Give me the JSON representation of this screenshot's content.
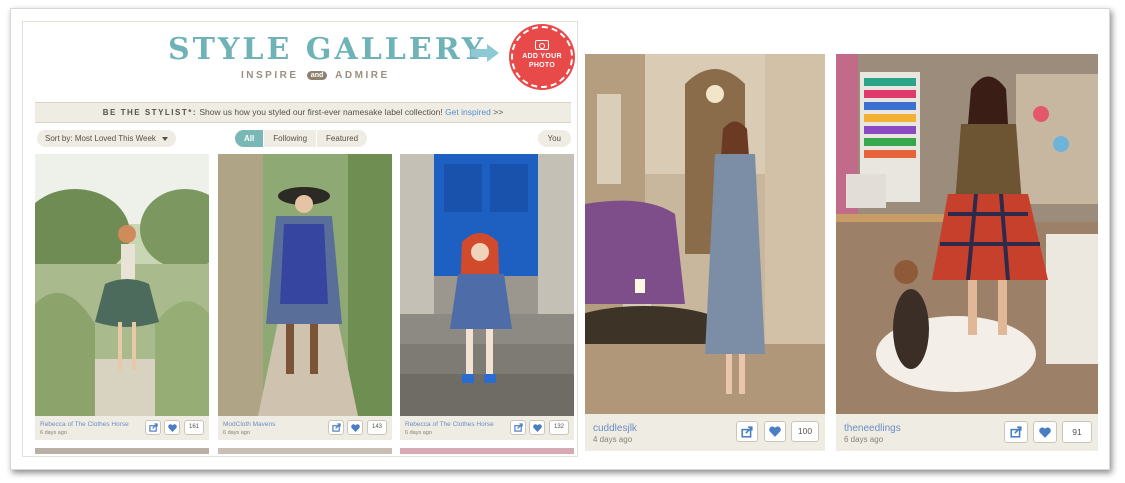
{
  "header": {
    "title": "STYLE GALLERY",
    "subtitle_left": "INSPIRE",
    "subtitle_and": "and",
    "subtitle_right": "ADMIRE",
    "add_photo_label_1": "ADD YOUR",
    "add_photo_label_2": "PHOTO",
    "accent_color": "#6fb3b8",
    "add_color": "#e84a4a"
  },
  "banner": {
    "lead": "BE THE STYLIST*:",
    "text": " Show us how you styled our first-ever namesake label collection! ",
    "link": "Get inspired",
    "suffix": " >>"
  },
  "controls": {
    "sort_label": "Sort by:",
    "sort_value": "Most Loved This Week",
    "tabs": [
      "All",
      "Following",
      "Featured"
    ],
    "active_tab": "All",
    "you_label": "You"
  },
  "cards": [
    {
      "author": "Rebecca of The Clothes Horse",
      "age": "6 days ago",
      "loves": "161"
    },
    {
      "author": "ModCloth Mavens",
      "age": "6 days ago",
      "loves": "143"
    },
    {
      "author": "Rebecca of The Clothes Horse",
      "age": "6 days ago",
      "loves": "132"
    },
    {
      "author": "cuddlesjlk",
      "age": "4 days ago",
      "loves": "100"
    },
    {
      "author": "theneedlings",
      "age": "6 days ago",
      "loves": "91"
    }
  ]
}
